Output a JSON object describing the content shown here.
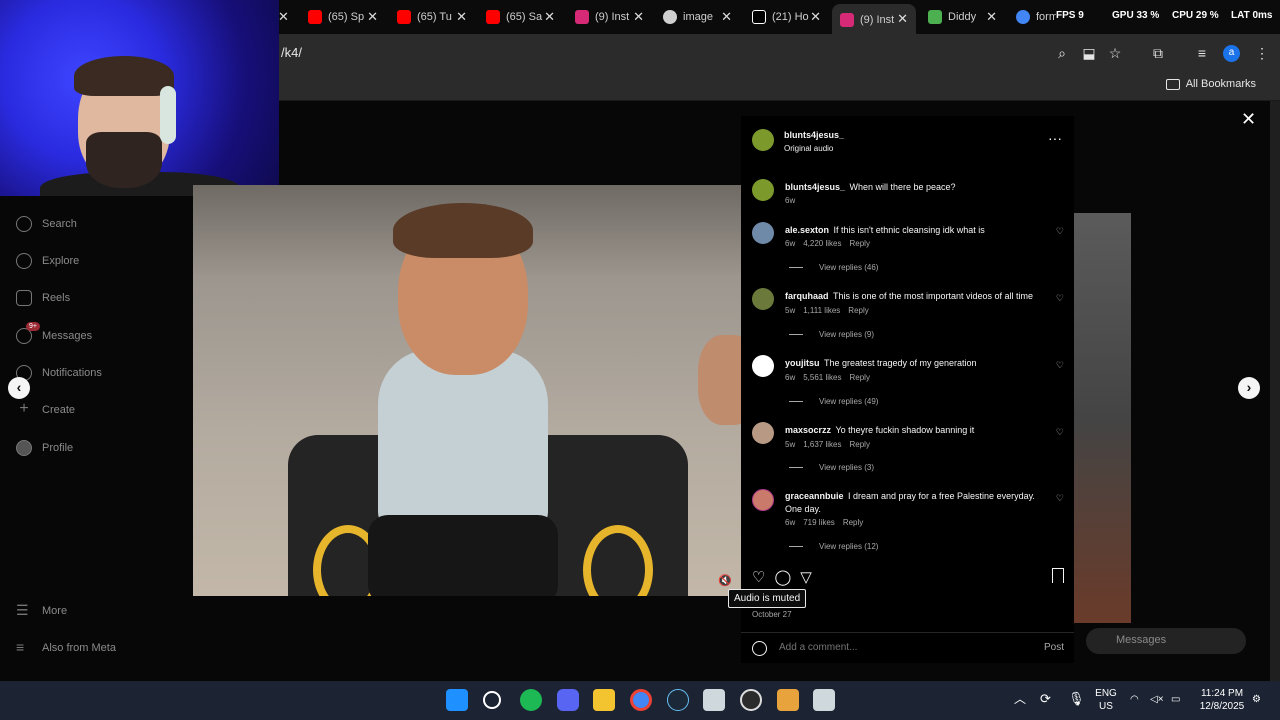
{
  "browser": {
    "tabs": [
      {
        "label": "(65) Sp",
        "icon": "youtube-icon",
        "color": "#ff0000"
      },
      {
        "label": "(65) Tu",
        "icon": "youtube-icon",
        "color": "#ff0000"
      },
      {
        "label": "(65) Sa",
        "icon": "youtube-icon",
        "color": "#ff0000"
      },
      {
        "label": "(9) Inst",
        "icon": "instagram-icon",
        "color": "#d62976"
      },
      {
        "label": "image",
        "icon": "globe-icon",
        "color": "#cfcfcf"
      },
      {
        "label": "(21) Ho",
        "icon": "x-icon",
        "color": "#ffffff"
      },
      {
        "label": "(9) Inst",
        "icon": "instagram-icon",
        "color": "#d62976"
      },
      {
        "label": "Diddy",
        "icon": "site-icon",
        "color": "#4caf50"
      },
      {
        "label": "form",
        "icon": "google-icon",
        "color": "#4285f4"
      }
    ],
    "perf": {
      "fps": "FPS 9",
      "gpu": "GPU 33 %",
      "cpu": "CPU 29 %",
      "lat": "LAT 0ms"
    },
    "url": "/k4/",
    "bookmarks_label": "All Bookmarks",
    "profile_initial": "a"
  },
  "sidebar": {
    "items": [
      {
        "label": "Search",
        "icon": "search-icon"
      },
      {
        "label": "Explore",
        "icon": "compass-icon"
      },
      {
        "label": "Reels",
        "icon": "reels-icon"
      },
      {
        "label": "Messages",
        "icon": "messenger-icon",
        "badge": "9+"
      },
      {
        "label": "Notifications",
        "icon": "heart-icon"
      },
      {
        "label": "Create",
        "icon": "plus-icon"
      },
      {
        "label": "Profile",
        "icon": "avatar-icon"
      },
      {
        "label": "More",
        "icon": "menu-icon"
      },
      {
        "label": "Also from Meta",
        "icon": "meta-icon"
      }
    ]
  },
  "post": {
    "author": "blunts4jesus_",
    "audio": "Original audio",
    "caption_user": "blunts4jesus_",
    "caption": "When will there be peace?",
    "caption_age": "6w",
    "comments": [
      {
        "user": "ale.sexton",
        "text": "If this isn't ethnic cleansing idk what is",
        "age": "6w",
        "likes": "4,220 likes",
        "reply": "Reply",
        "replies": "View replies (46)"
      },
      {
        "user": "farquhaad",
        "text": "This is one of the most important videos of all time",
        "age": "5w",
        "likes": "1,111 likes",
        "reply": "Reply",
        "replies": "View replies (9)"
      },
      {
        "user": "youjitsu",
        "text": "The greatest tragedy of my generation",
        "age": "6w",
        "likes": "5,561 likes",
        "reply": "Reply",
        "replies": "View replies (49)"
      },
      {
        "user": "maxsocrzz",
        "text": "Yo theyre fuckin shadow banning it",
        "age": "5w",
        "likes": "1,637 likes",
        "reply": "Reply",
        "replies": "View replies (3)"
      },
      {
        "user": "graceannbuie",
        "text": "I dream and pray for a free Palestine everyday. One day.",
        "age": "6w",
        "likes": "719 likes",
        "reply": "Reply",
        "replies": "View replies (12)"
      }
    ],
    "tooltip": "Audio is muted",
    "date": "October 27",
    "comment_placeholder": "Add a comment...",
    "post_label": "Post",
    "messages_pill": "Messages"
  },
  "taskbar": {
    "apps": [
      "windows-start-icon",
      "search-icon",
      "spotify-icon",
      "discord-icon",
      "file-explorer-icon",
      "chrome-icon",
      "steam-icon",
      "app-icon",
      "obs-icon",
      "app-icon",
      "app-icon"
    ],
    "lang": "ENG",
    "region": "US",
    "time": "11:24 PM",
    "date": "12/8/2025"
  }
}
